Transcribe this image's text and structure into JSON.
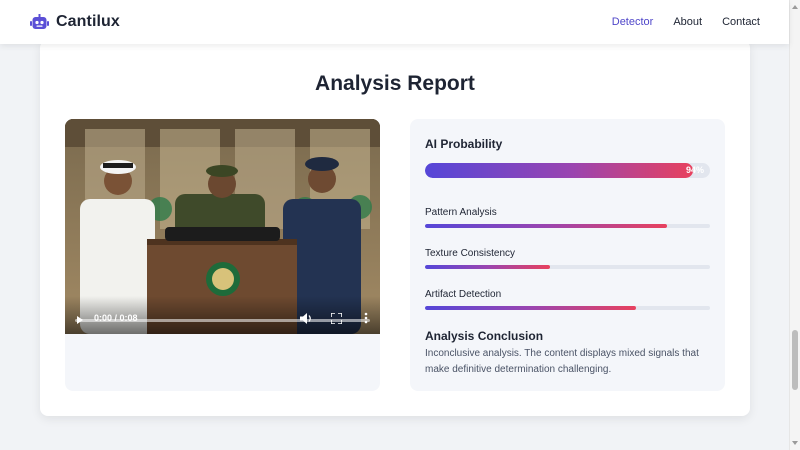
{
  "header": {
    "brand_name": "Cantilux",
    "brand_icon": "robot-icon",
    "nav": [
      {
        "label": "Detector",
        "active": true
      },
      {
        "label": "About",
        "active": false
      },
      {
        "label": "Contact",
        "active": false
      }
    ],
    "colors": {
      "accent": "#4f46c9",
      "text": "#1e2433"
    }
  },
  "report": {
    "title": "Analysis Report",
    "video": {
      "time": "0:00 / 0:08",
      "icons": [
        "play-icon",
        "volume-icon",
        "fullscreen-icon",
        "more-options-icon"
      ]
    },
    "ai_probability": {
      "title": "AI Probability",
      "value": 0.94,
      "value_label": "94%"
    },
    "metrics": [
      {
        "label": "Pattern Analysis",
        "value": 0.85
      },
      {
        "label": "Texture Consistency",
        "value": 0.44
      },
      {
        "label": "Artifact Detection",
        "value": 0.74
      }
    ],
    "conclusion": {
      "title": "Analysis Conclusion",
      "text": "Inconclusive analysis. The content displays mixed signals that make definitive determination challenging."
    },
    "colors": {
      "gradient_start": "#5546d8",
      "gradient_mid": "#9a45b0",
      "gradient_end": "#e8415e",
      "track": "#e2e6ee"
    }
  }
}
